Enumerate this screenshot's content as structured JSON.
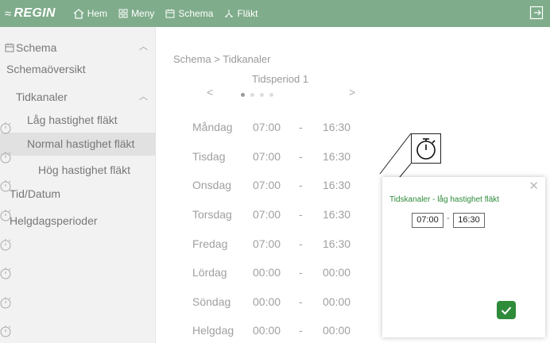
{
  "topbar": {
    "brand": "REGIN",
    "nav": [
      {
        "label": "Hem",
        "icon": "home-icon"
      },
      {
        "label": "Meny",
        "icon": "grid-icon"
      },
      {
        "label": "Schema",
        "icon": "calendar-icon"
      },
      {
        "label": "Fläkt",
        "icon": "fan-icon"
      }
    ],
    "bg_color": "#7fac8b"
  },
  "sidebar": {
    "items": [
      {
        "label": "Schema",
        "icon": "calendar-icon",
        "expanded": true
      },
      {
        "label": "Schemaöversikt"
      },
      {
        "label": "Tidkanaler",
        "expanded": true
      },
      {
        "label": "Låg hastighet fläkt"
      },
      {
        "label": "Normal hastighet fläkt",
        "selected": true
      },
      {
        "label": "Hög hastighet fläkt"
      },
      {
        "label": "Tid/Datum"
      },
      {
        "label": "Helgdagsperioder"
      }
    ]
  },
  "main": {
    "breadcrumb": "Schema > Tidkanaler",
    "period_title": "Tidsperiod 1",
    "prev": "<",
    "next": ">",
    "pager": {
      "pages": 4,
      "current": 1
    },
    "rows": [
      {
        "day": "Måndag",
        "start": "07:00",
        "dash": "-",
        "end": "16:30"
      },
      {
        "day": "Tisdag",
        "start": "07:00",
        "dash": "-",
        "end": "16:30"
      },
      {
        "day": "Onsdag",
        "start": "07:00",
        "dash": "-",
        "end": "16:30"
      },
      {
        "day": "Torsdag",
        "start": "07:00",
        "dash": "-",
        "end": "16:30"
      },
      {
        "day": "Fredag",
        "start": "07:00",
        "dash": "-",
        "end": "16:30"
      },
      {
        "day": "Lördag",
        "start": "00:00",
        "dash": "-",
        "end": "00:00"
      },
      {
        "day": "Söndag",
        "start": "00:00",
        "dash": "-",
        "end": "00:00"
      },
      {
        "day": "Helgdag",
        "start": "00:00",
        "dash": "-",
        "end": "00:00"
      }
    ]
  },
  "popup": {
    "title": "Tidskanaler - låg hastighet fläkt",
    "start": "07:00",
    "separator": "-",
    "end": "16:30",
    "close": "✕",
    "accent": "#2e8b3a"
  }
}
